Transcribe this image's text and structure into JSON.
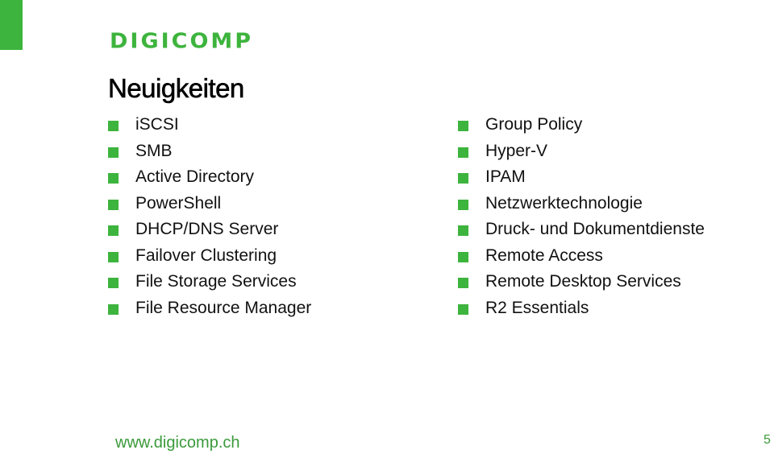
{
  "brand": {
    "logo_text": "DIGICOMP",
    "accent_color": "#3db43d"
  },
  "slide": {
    "title": "Neuigkeiten",
    "left_items": [
      "iSCSI",
      "SMB",
      "Active Directory",
      "PowerShell",
      "DHCP/DNS Server",
      "Failover Clustering",
      "File Storage Services",
      "File Resource Manager"
    ],
    "right_items": [
      "Group Policy",
      "Hyper-V",
      "IPAM",
      "Netzwerktechnologie",
      "Druck- und Dokumentdienste",
      "Remote Access",
      "Remote Desktop Services",
      "R2 Essentials"
    ],
    "bullet_icon": "square-bullet-icon"
  },
  "footer": {
    "url": "www.digicomp.ch",
    "page_number": "5"
  }
}
